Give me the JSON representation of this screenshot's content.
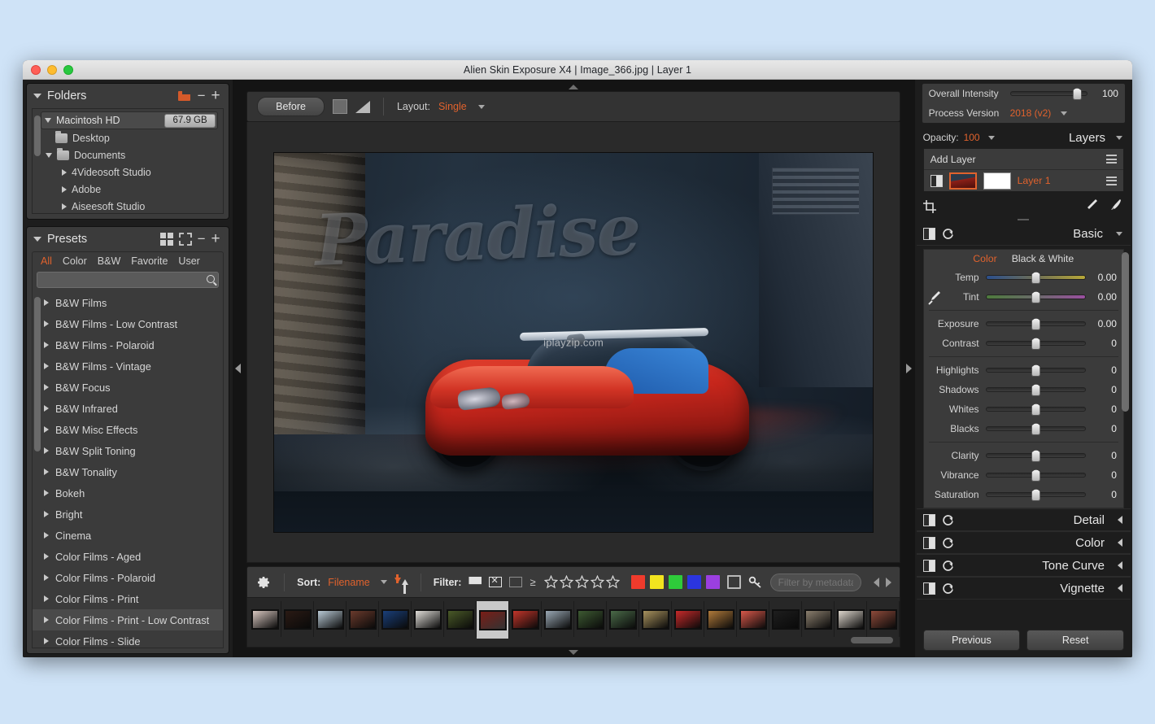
{
  "window": {
    "title": "Alien Skin Exposure X4 | Image_366.jpg | Layer 1"
  },
  "folders": {
    "title": "Folders",
    "add_folder_icon": "add-folder-icon",
    "minus_label": "−",
    "plus_label": "+",
    "drive": {
      "name": "Macintosh HD",
      "size": "67.9 GB"
    },
    "items": [
      {
        "label": "Desktop",
        "depth": 2,
        "expander": "none",
        "folder": true
      },
      {
        "label": "Documents",
        "depth": 2,
        "expander": "down",
        "folder": true
      },
      {
        "label": "4Videosoft Studio",
        "depth": 3,
        "expander": "right",
        "folder": false
      },
      {
        "label": "Adobe",
        "depth": 3,
        "expander": "right",
        "folder": false
      },
      {
        "label": "Aiseesoft Studio",
        "depth": 3,
        "expander": "right",
        "folder": false
      }
    ]
  },
  "presets": {
    "title": "Presets",
    "minus_label": "−",
    "plus_label": "+",
    "filters": [
      {
        "label": "All",
        "active": true
      },
      {
        "label": "Color",
        "active": false
      },
      {
        "label": "B&W",
        "active": false
      },
      {
        "label": "Favorite",
        "active": false
      },
      {
        "label": "User",
        "active": false
      }
    ],
    "search_value": "",
    "search_placeholder": "",
    "items": [
      {
        "label": "B&W Films",
        "highlight": false
      },
      {
        "label": "B&W Films - Low Contrast",
        "highlight": false
      },
      {
        "label": "B&W Films - Polaroid",
        "highlight": false
      },
      {
        "label": "B&W Films - Vintage",
        "highlight": false
      },
      {
        "label": "B&W Focus",
        "highlight": false
      },
      {
        "label": "B&W Infrared",
        "highlight": false
      },
      {
        "label": "B&W Misc Effects",
        "highlight": false
      },
      {
        "label": "B&W Split Toning",
        "highlight": false
      },
      {
        "label": "B&W Tonality",
        "highlight": false
      },
      {
        "label": "Bokeh",
        "highlight": false
      },
      {
        "label": "Bright",
        "highlight": false
      },
      {
        "label": "Cinema",
        "highlight": false
      },
      {
        "label": "Color Films - Aged",
        "highlight": false
      },
      {
        "label": "Color Films - Polaroid",
        "highlight": false
      },
      {
        "label": "Color Films - Print",
        "highlight": false
      },
      {
        "label": "Color Films - Print - Low Contrast",
        "highlight": true
      },
      {
        "label": "Color Films - Slide",
        "highlight": false
      }
    ]
  },
  "viewer": {
    "before_button": "Before",
    "layout_label": "Layout:",
    "layout_value": "Single",
    "image": {
      "graffiti_text": "Paradise",
      "watermark": "iplayzip.com"
    }
  },
  "filmstrip": {
    "sort_label": "Sort:",
    "sort_value": "Filename",
    "filter_label": "Filter:",
    "rating_prefix": "≥",
    "stars": 5,
    "color_swatches": [
      "#ef3b2c",
      "#f2e41f",
      "#2ecb3a",
      "#2b35e0",
      "#9b3fe0"
    ],
    "empty_swatch_label": "no-color",
    "metadata_value": "",
    "metadata_placeholder": "Filter by metadata",
    "thumbnails": [
      {
        "selected": false,
        "tone": "#d8c7c0"
      },
      {
        "selected": false,
        "tone": "#2a1a14"
      },
      {
        "selected": false,
        "tone": "#b9cad6"
      },
      {
        "selected": false,
        "tone": "#6a3a2c"
      },
      {
        "selected": false,
        "tone": "#1a3f7a"
      },
      {
        "selected": false,
        "tone": "#e0ddd8"
      },
      {
        "selected": false,
        "tone": "#4a5a28"
      },
      {
        "selected": true,
        "tone": "#7a1d16"
      },
      {
        "selected": false,
        "tone": "#c2352a"
      },
      {
        "selected": false,
        "tone": "#9aa8b4"
      },
      {
        "selected": false,
        "tone": "#3d5a32"
      },
      {
        "selected": false,
        "tone": "#4a6a48"
      },
      {
        "selected": false,
        "tone": "#a8925e"
      },
      {
        "selected": false,
        "tone": "#c62a2a"
      },
      {
        "selected": false,
        "tone": "#b07a3a"
      },
      {
        "selected": false,
        "tone": "#d8584a"
      },
      {
        "selected": false,
        "tone": "#1e1e1e"
      },
      {
        "selected": false,
        "tone": "#8b7f6e"
      },
      {
        "selected": false,
        "tone": "#ddd6cc"
      },
      {
        "selected": false,
        "tone": "#8e4a3a"
      }
    ]
  },
  "right_panel": {
    "overall_intensity": {
      "label": "Overall Intensity",
      "value": "100"
    },
    "process_version": {
      "label": "Process Version",
      "value": "2018 (v2)"
    },
    "opacity": {
      "label": "Opacity:",
      "value": "100"
    },
    "layers_title": "Layers",
    "add_layer_label": "Add Layer",
    "layer": {
      "name": "Layer 1"
    },
    "basic": {
      "title": "Basic",
      "tabs": [
        {
          "label": "Color",
          "active": true
        },
        {
          "label": "Black & White",
          "active": false
        }
      ],
      "white_balance": [
        {
          "label": "Temp",
          "value": "0.00",
          "pos": 50,
          "track": "temp"
        },
        {
          "label": "Tint",
          "value": "0.00",
          "pos": 50,
          "track": "tint"
        }
      ],
      "tone_group_1": [
        {
          "label": "Exposure",
          "value": "0.00",
          "pos": 50
        },
        {
          "label": "Contrast",
          "value": "0",
          "pos": 50
        }
      ],
      "tone_group_2": [
        {
          "label": "Highlights",
          "value": "0",
          "pos": 50
        },
        {
          "label": "Shadows",
          "value": "0",
          "pos": 50
        },
        {
          "label": "Whites",
          "value": "0",
          "pos": 50
        },
        {
          "label": "Blacks",
          "value": "0",
          "pos": 50
        }
      ],
      "presence_group": [
        {
          "label": "Clarity",
          "value": "0",
          "pos": 50
        },
        {
          "label": "Vibrance",
          "value": "0",
          "pos": 50
        },
        {
          "label": "Saturation",
          "value": "0",
          "pos": 50
        }
      ]
    },
    "collapsed_sections": [
      {
        "title": "Detail"
      },
      {
        "title": "Color"
      },
      {
        "title": "Tone Curve"
      },
      {
        "title": "Vignette"
      }
    ],
    "previous_button": "Previous",
    "reset_button": "Reset"
  }
}
